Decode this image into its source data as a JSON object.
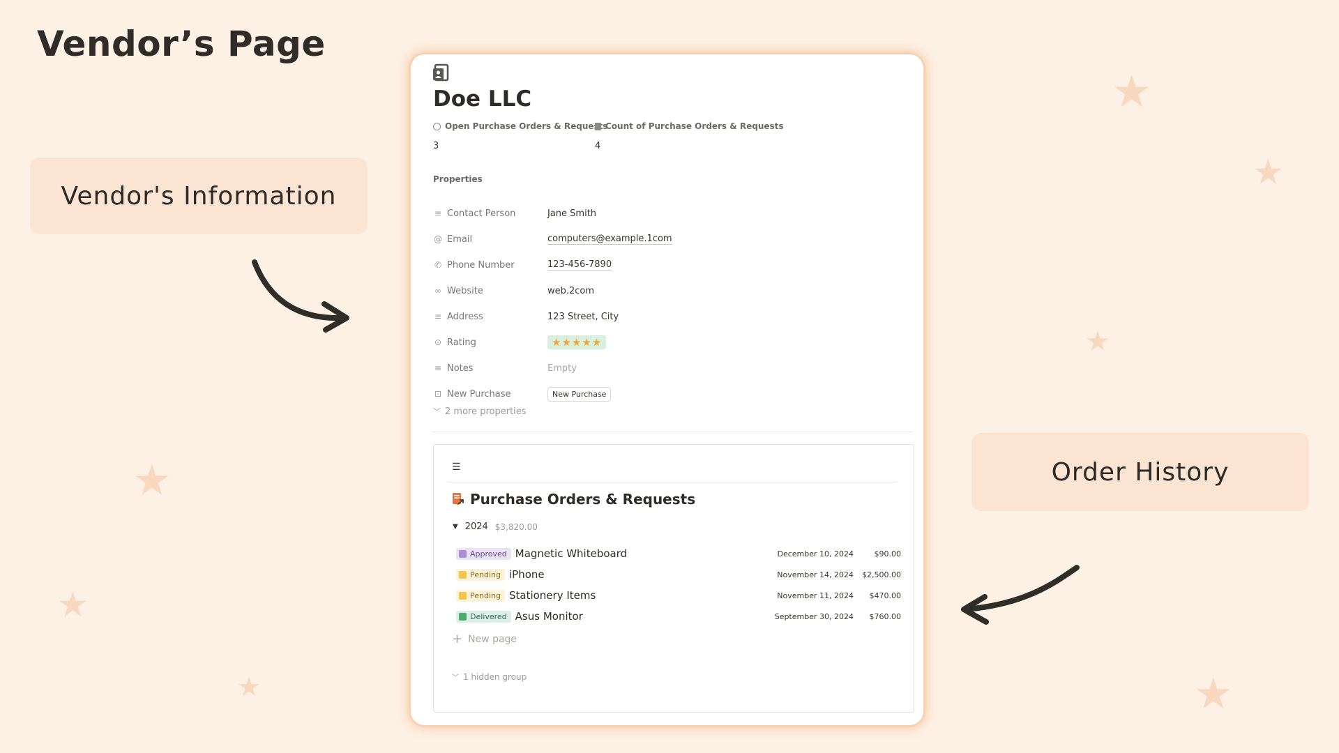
{
  "heading": "Vendor’s Page",
  "callouts": {
    "vendor_info": "Vendor's Information",
    "order_history": "Order History"
  },
  "vendor": {
    "name": "Doe LLC",
    "rollups": [
      {
        "label": "Open Purchase Orders & Requests",
        "value": "3",
        "icon": "circle-icon"
      },
      {
        "label": "Count of Purchase Orders & Requests",
        "value": "4",
        "icon": "document-icon"
      }
    ],
    "properties_label": "Properties",
    "properties": [
      {
        "key": "Contact Person",
        "value": "Jane Smith",
        "icon": "text-lines-icon"
      },
      {
        "key": "Email",
        "value": "computers@example.1com",
        "icon": "at-icon"
      },
      {
        "key": "Phone Number",
        "value": "123-456-7890",
        "icon": "phone-icon"
      },
      {
        "key": "Website",
        "value": "web.2com",
        "icon": "link-icon"
      },
      {
        "key": "Address",
        "value": "123 Street, City",
        "icon": "text-lines-icon"
      },
      {
        "key": "Rating",
        "value": "★★★★★",
        "rating": 5,
        "icon": "rating-icon"
      },
      {
        "key": "Notes",
        "value": "Empty",
        "icon": "text-lines-icon"
      },
      {
        "key": "New Purchase",
        "value": "New Purchase",
        "icon": "button-icon"
      }
    ],
    "more_properties": "2 more properties"
  },
  "orders": {
    "title": "Purchase Orders & Requests",
    "group": {
      "year": "2024",
      "sum": "$3,820.00"
    },
    "rows": [
      {
        "status": "Approved",
        "title": "Magnetic Whiteboard",
        "date": "December 10, 2024",
        "amount": "$90.00",
        "status_bg": "#eae4f2",
        "status_color": "#6940a5",
        "status_sq": "#a98fd4"
      },
      {
        "status": "Pending",
        "title": "iPhone",
        "date": "November 14, 2024",
        "amount": "$2,500.00",
        "status_bg": "#fbf3db",
        "status_color": "#8a6a17",
        "status_sq": "#f5c64b"
      },
      {
        "status": "Pending",
        "title": "Stationery Items",
        "date": "November 11, 2024",
        "amount": "$470.00",
        "status_bg": "#fbf3db",
        "status_color": "#8a6a17",
        "status_sq": "#f5c64b"
      },
      {
        "status": "Delivered",
        "title": "Asus Monitor",
        "date": "September 30, 2024",
        "amount": "$760.00",
        "status_bg": "#ddedea",
        "status_color": "#2f6e4a",
        "status_sq": "#4dab6d"
      }
    ],
    "new_page": "New page",
    "hidden_group": "1 hidden group"
  },
  "colors": {
    "background": "#fdf0e4",
    "callout_bg": "#fbe4d2",
    "star": "#f8d9c0",
    "card_glow": "#f0a86e"
  }
}
